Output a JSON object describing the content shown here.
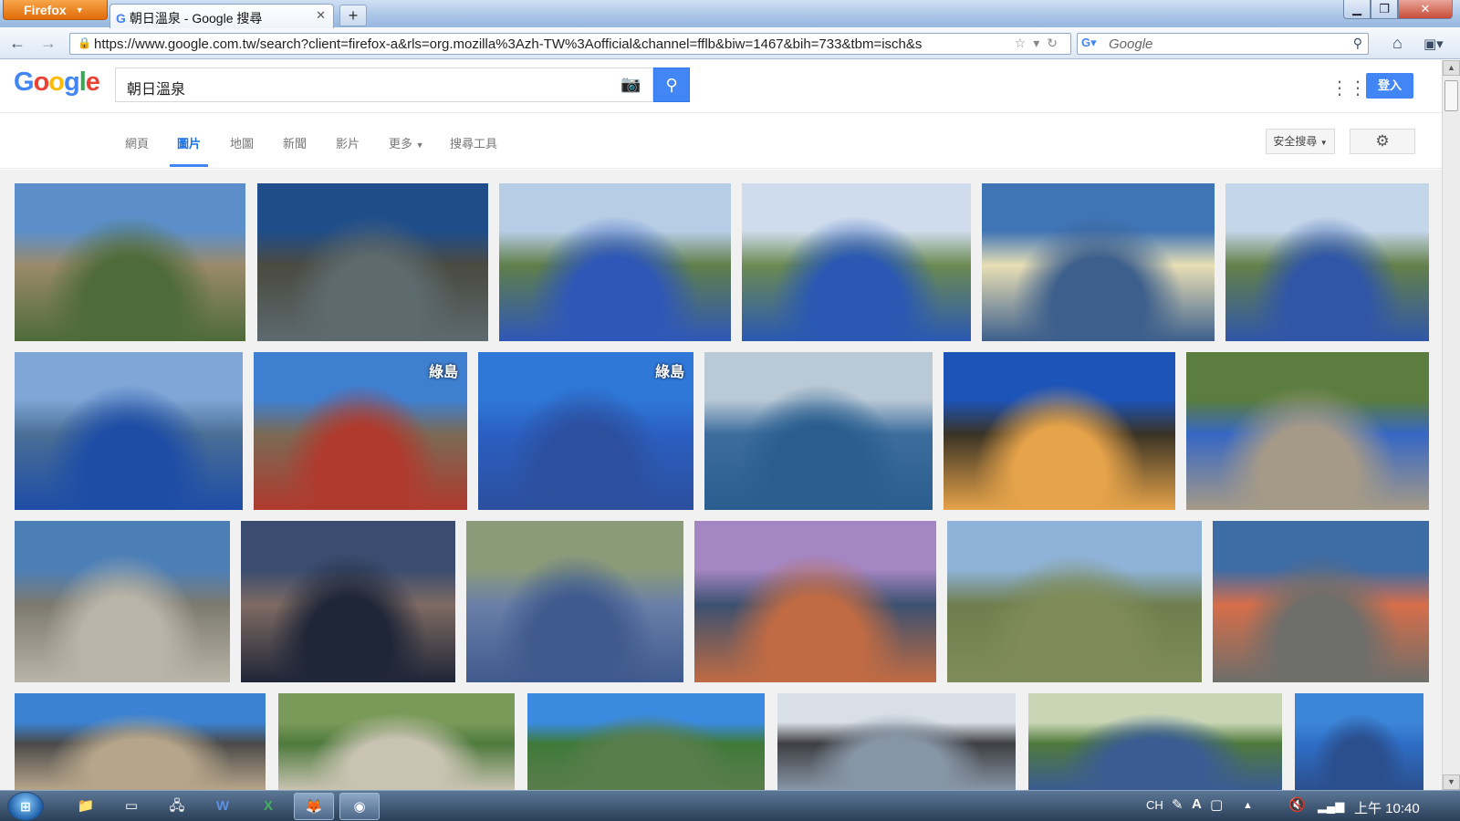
{
  "browser": {
    "menu_label": "Firefox",
    "tab_title": "朝日溫泉 - Google 搜尋",
    "url": "https://www.google.com.tw/search?client=firefox-a&rls=org.mozilla%3Azh-TW%3Aofficial&channel=fflb&biw=1467&bih=733&tbm=isch&s",
    "search_placeholder": "Google"
  },
  "google": {
    "query": "朝日溫泉",
    "signin_label": "登入",
    "tabs": [
      {
        "label": "網頁"
      },
      {
        "label": "圖片",
        "active": true
      },
      {
        "label": "地圖"
      },
      {
        "label": "新聞"
      },
      {
        "label": "影片"
      },
      {
        "label": "更多"
      },
      {
        "label": "搜尋工具"
      }
    ],
    "safesearch_label": "安全搜尋"
  },
  "images": [
    {
      "row": 0,
      "overlay": "",
      "sky": "#5c8fc9",
      "mid": "#9a8a6a",
      "low": "#4e6b3a"
    },
    {
      "row": 0,
      "overlay": "",
      "sky": "#1f4d8a",
      "mid": "#4a4a40",
      "low": "#5d6a6e"
    },
    {
      "row": 0,
      "overlay": "",
      "sky": "#b7cde6",
      "mid": "#5f7f4a",
      "low": "#2f57b8"
    },
    {
      "row": 0,
      "overlay": "",
      "sky": "#cfdced",
      "mid": "#6b8a52",
      "low": "#2a58b3"
    },
    {
      "row": 0,
      "overlay": "",
      "sky": "#3f74b5",
      "mid": "#e8dfb5",
      "low": "#3d5f8c"
    },
    {
      "row": 0,
      "overlay": "",
      "sky": "#c4d6ea",
      "mid": "#64804a",
      "low": "#3056a8"
    },
    {
      "row": 1,
      "overlay": "",
      "sky": "#7fa6d6",
      "mid": "#4a6e95",
      "low": "#1e4da6"
    },
    {
      "row": 1,
      "overlay": "綠島",
      "sky": "#3f7fd0",
      "mid": "#7a6a55",
      "low": "#b03a2e"
    },
    {
      "row": 1,
      "overlay": "綠島",
      "sky": "#2f78d8",
      "mid": "#2b5fc1",
      "low": "#2c4f9e"
    },
    {
      "row": 1,
      "overlay": "",
      "sky": "#b9c9d6",
      "mid": "#3d6d9d",
      "low": "#2a5e8e"
    },
    {
      "row": 1,
      "overlay": "",
      "sky": "#1d54b8",
      "mid": "#3a3325",
      "low": "#e5a34a"
    },
    {
      "row": 1,
      "overlay": "",
      "sky": "#5b7d3f",
      "mid": "#3667c4",
      "low": "#a59a88"
    },
    {
      "row": 2,
      "overlay": "",
      "sky": "#4d7fb7",
      "mid": "#7d7a6f",
      "low": "#b8b4a8"
    },
    {
      "row": 2,
      "overlay": "",
      "sky": "#3a4c6f",
      "mid": "#7e6a63",
      "low": "#1f2638"
    },
    {
      "row": 2,
      "overlay": "",
      "sky": "#8b9b7a",
      "mid": "#6a7fa8",
      "low": "#3f5a8e"
    },
    {
      "row": 2,
      "overlay": "",
      "sky": "#a486c2",
      "mid": "#3c5170",
      "low": "#c06b43"
    },
    {
      "row": 2,
      "overlay": "",
      "sky": "#8fb3d8",
      "mid": "#6f7e4e",
      "low": "#7f8c5a"
    },
    {
      "row": 2,
      "overlay": "",
      "sky": "#3e6ca5",
      "mid": "#d66e4a",
      "low": "#6e6e6a"
    },
    {
      "row": 3,
      "overlay": "",
      "sky": "#3b82d2",
      "mid": "#4a4a4a",
      "low": "#b6a58a"
    },
    {
      "row": 3,
      "overlay": "",
      "sky": "#7a9a5a",
      "mid": "#4e7a3c",
      "low": "#c9c3b2"
    },
    {
      "row": 3,
      "overlay": "",
      "sky": "#3a8be0",
      "mid": "#3f7a3a",
      "low": "#5a7d4c"
    },
    {
      "row": 3,
      "overlay": "",
      "sky": "#d8dfe6",
      "mid": "#3e3e42",
      "low": "#8796a6"
    },
    {
      "row": 3,
      "overlay": "",
      "sky": "#c9d6b5",
      "mid": "#4f7a3c",
      "low": "#3a5c93"
    },
    {
      "row": 3,
      "overlay": "",
      "sky": "#3c86d8",
      "mid": "#2f6ec6",
      "low": "#2b4f8e"
    }
  ],
  "taskbar": {
    "start_label": "⊞",
    "lang": "CH",
    "clock": "上午 10:40"
  }
}
